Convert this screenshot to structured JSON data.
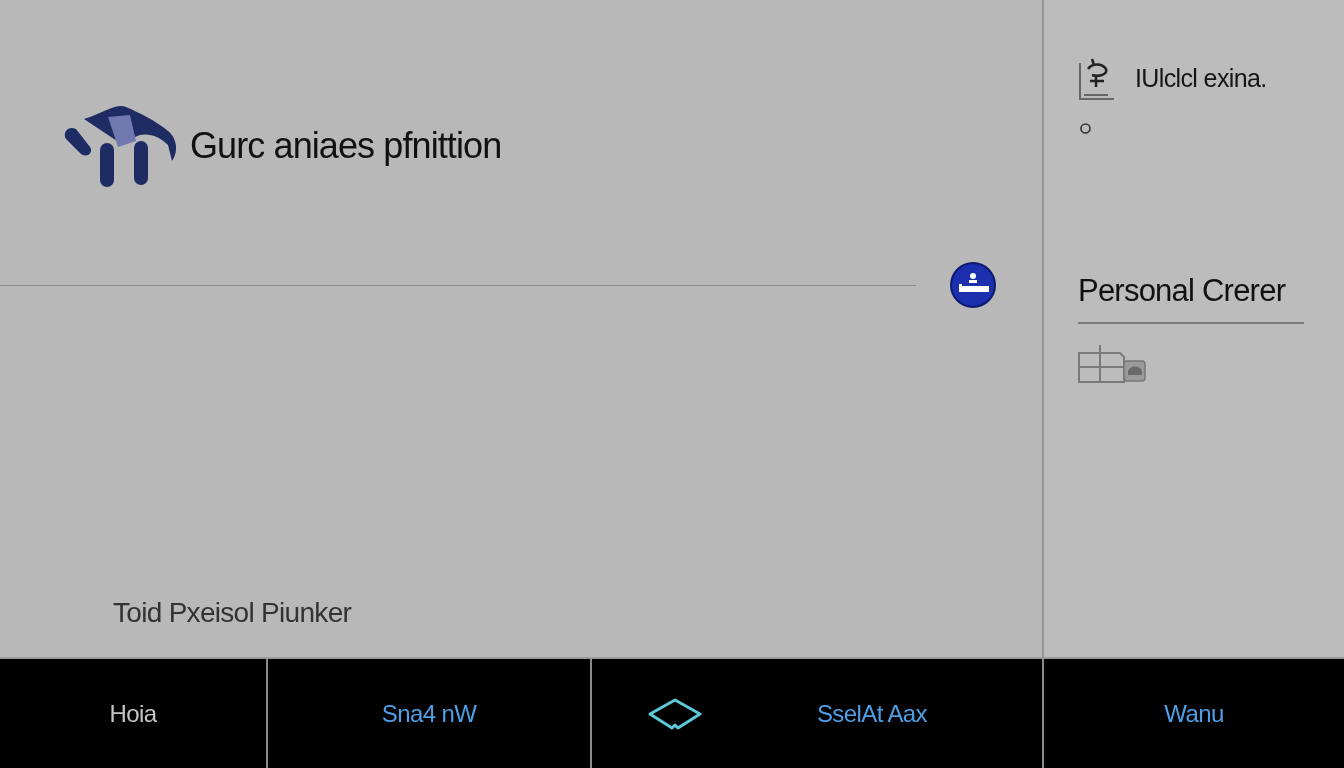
{
  "header": {
    "title": "Gurc aniaes pfnittion"
  },
  "caption": "Toid Pxeisol Piunker",
  "sidebar": {
    "label": "IUlclcl exina.",
    "heading": "Personal Crerer"
  },
  "nav": [
    {
      "label": "Hoia",
      "selected": true,
      "kind": "text"
    },
    {
      "label": "Sna4 nW",
      "selected": false,
      "kind": "text"
    },
    {
      "label": "SselAt Aax",
      "selected": false,
      "kind": "icon"
    },
    {
      "label": "Wanu",
      "selected": false,
      "kind": "text"
    }
  ]
}
